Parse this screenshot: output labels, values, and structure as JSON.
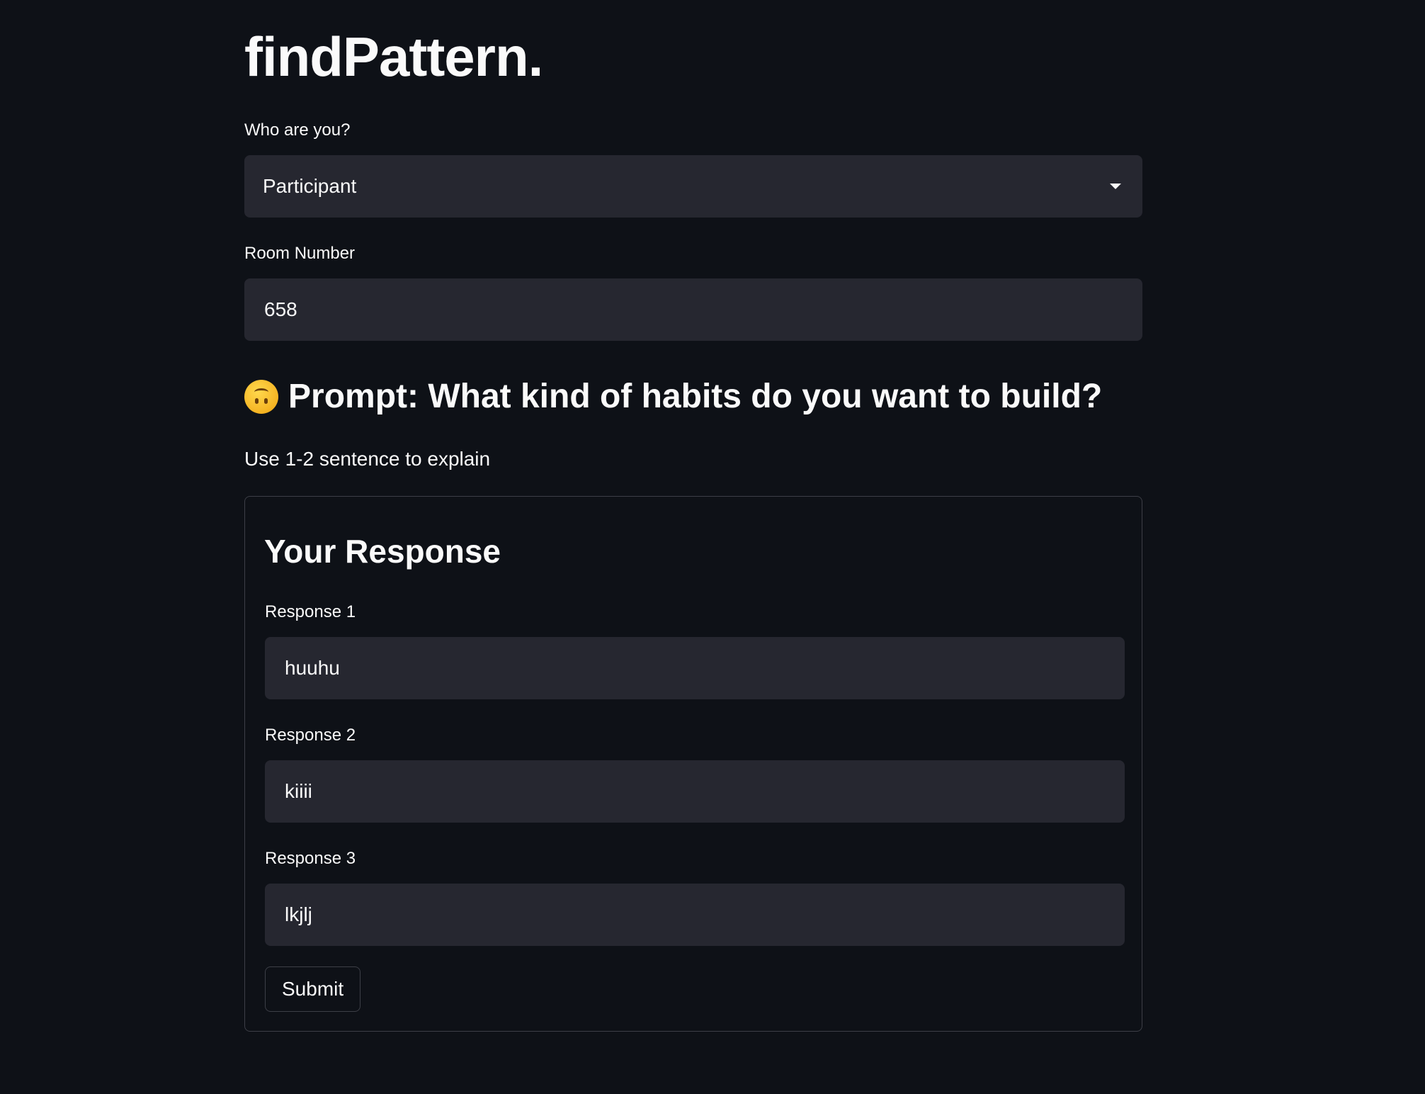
{
  "app": {
    "title": "findPattern."
  },
  "role": {
    "label": "Who are you?",
    "selected": "Participant"
  },
  "room": {
    "label": "Room Number",
    "value": "658"
  },
  "prompt": {
    "emoji": "upside-down-face-icon",
    "heading": "Prompt: What kind of habits do you want to build?",
    "instruction": "Use 1-2 sentence to explain"
  },
  "form": {
    "title": "Your Response",
    "responses": [
      {
        "label": "Response 1",
        "value": "huuhu"
      },
      {
        "label": "Response 2",
        "value": "kiiii"
      },
      {
        "label": "Response 3",
        "value": "lkjlj"
      }
    ],
    "submit_label": "Submit"
  },
  "colors": {
    "background": "#0e1117",
    "input_background": "#262730",
    "text": "#fafafa",
    "border": "#3d3f47"
  }
}
